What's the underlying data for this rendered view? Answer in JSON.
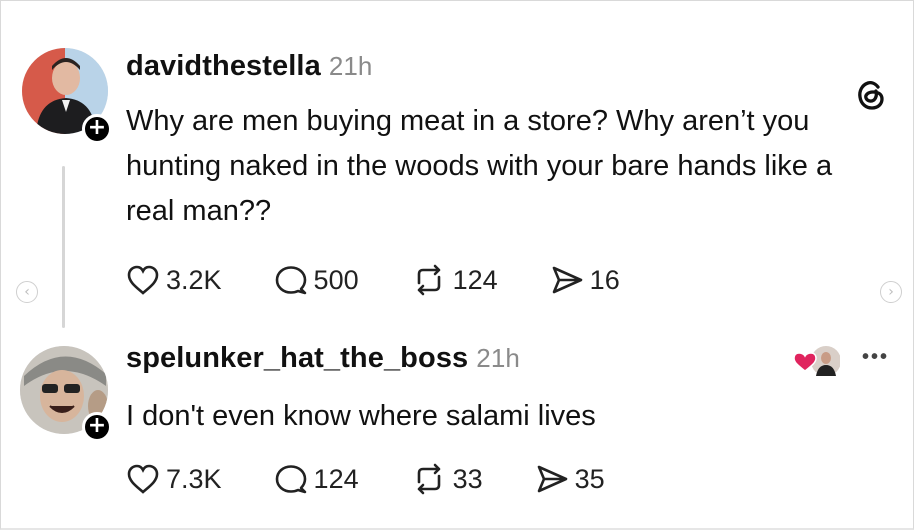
{
  "posts": [
    {
      "username": "davidthestella",
      "time": "21h",
      "text": "Why are men buying meat in a store? Why aren’t you hunting naked in the woods with your bare hands like a real man??",
      "likes": "3.2K",
      "replies": "500",
      "reposts": "124",
      "shares": "16"
    },
    {
      "username": "spelunker_hat_the_boss",
      "time": "21h",
      "text": "I don't even know where salami lives",
      "likes": "7.3K",
      "replies": "124",
      "reposts": "33",
      "shares": "35"
    }
  ],
  "icons": {
    "logo": "threads-logo-icon",
    "follow": "plus-icon",
    "like": "heart-icon",
    "reply": "comment-icon",
    "repost": "repost-icon",
    "share": "share-icon",
    "more": "more-icon",
    "prev": "chevron-left-icon",
    "next": "chevron-right-icon"
  },
  "colors": {
    "reaction_heart": "#e0245e",
    "muted": "#8a8a8a"
  }
}
